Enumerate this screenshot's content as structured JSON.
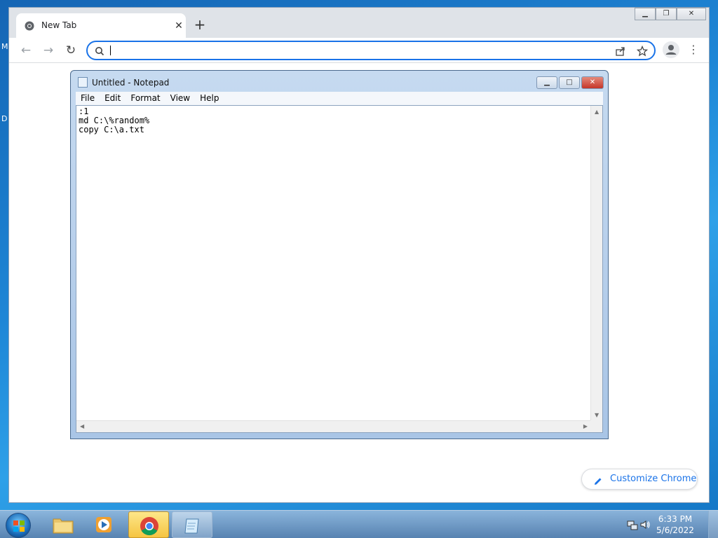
{
  "chrome": {
    "tab_title": "New Tab",
    "address_placeholder": "",
    "customize_label": "Customize Chrome"
  },
  "notepad": {
    "title": "Untitled - Notepad",
    "menu": [
      "File",
      "Edit",
      "Format",
      "View",
      "Help"
    ],
    "content": ":1\nmd C:\\%random%\ncopy C:\\a.txt "
  },
  "taskbar": {
    "time": "6:33 PM",
    "date": "5/6/2022"
  },
  "desktop_edge": [
    "M",
    "D"
  ],
  "colors": {
    "chrome_accent": "#1a73e8",
    "taskbar_active": "#f5c542"
  }
}
